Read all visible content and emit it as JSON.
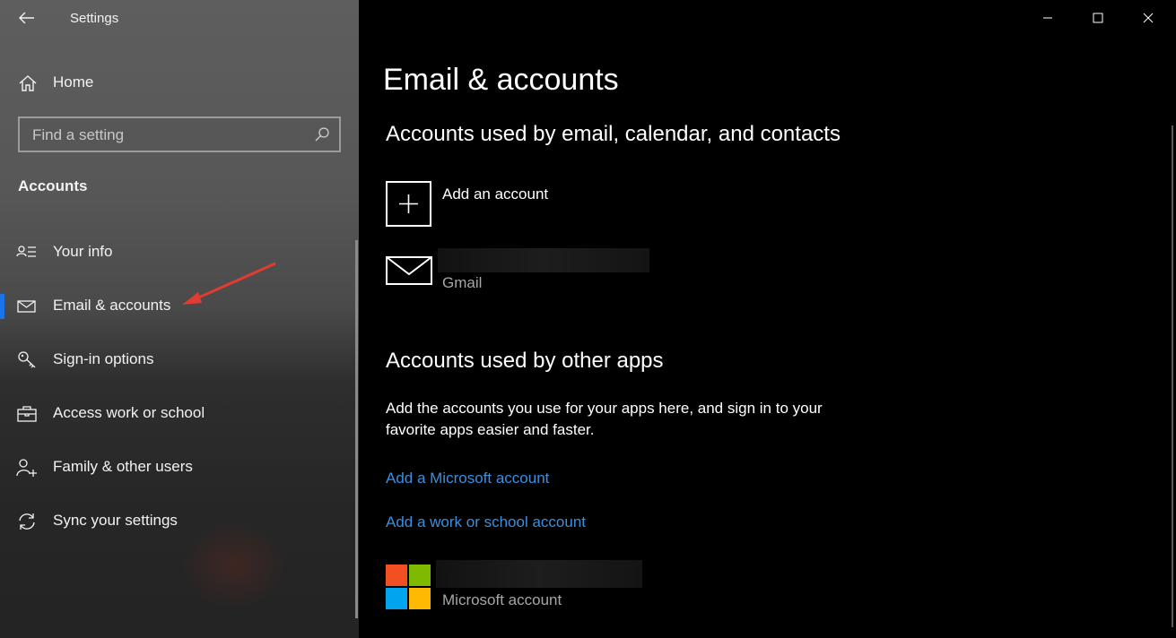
{
  "window": {
    "app_title": "Settings",
    "controls": [
      "minimize-icon",
      "maximize-icon",
      "close-icon"
    ]
  },
  "sidebar": {
    "home_label": "Home",
    "search": {
      "placeholder": "Find a setting"
    },
    "section_title": "Accounts",
    "items": [
      {
        "label": "Your info",
        "icon": "person-list-icon",
        "active": false
      },
      {
        "label": "Email & accounts",
        "icon": "mail-icon",
        "active": true
      },
      {
        "label": "Sign-in options",
        "icon": "key-icon",
        "active": false
      },
      {
        "label": "Access work or school",
        "icon": "briefcase-icon",
        "active": false
      },
      {
        "label": "Family & other users",
        "icon": "add-person-icon",
        "active": false
      },
      {
        "label": "Sync your settings",
        "icon": "sync-icon",
        "active": false
      }
    ],
    "accent_color": "#1a73e8"
  },
  "main": {
    "title": "Email & accounts",
    "email_section": {
      "heading": "Accounts used by email, calendar, and contacts",
      "add_account_label": "Add an account",
      "accounts": [
        {
          "type": "Gmail"
        }
      ]
    },
    "apps_section": {
      "heading": "Accounts used by other apps",
      "description": "Add the accounts you use for your apps here, and sign in to your favorite apps easier and faster.",
      "links": [
        "Add a Microsoft account",
        "Add a work or school account"
      ],
      "accounts": [
        {
          "type": "Microsoft account"
        }
      ]
    },
    "link_color": "#3a8fde"
  }
}
